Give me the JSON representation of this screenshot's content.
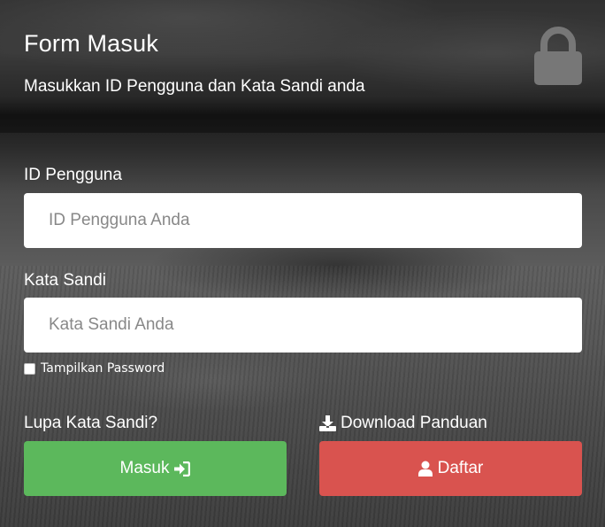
{
  "header": {
    "title": "Form Masuk",
    "subtitle": "Masukkan ID Pengguna dan Kata Sandi anda",
    "icon": "lock-icon"
  },
  "form": {
    "username": {
      "label": "ID Pengguna",
      "placeholder": "ID Pengguna Anda",
      "value": ""
    },
    "password": {
      "label": "Kata Sandi",
      "placeholder": "Kata Sandi Anda",
      "value": ""
    },
    "show_password": {
      "label": "Tampilkan Password",
      "checked": false
    }
  },
  "links": {
    "forgot_password": "Lupa Kata Sandi?",
    "download_guide": "Download Panduan",
    "download_icon": "download-icon"
  },
  "buttons": {
    "login": {
      "label": "Masuk",
      "icon": "sign-in-icon",
      "color": "#5cb85c"
    },
    "register": {
      "label": "Daftar",
      "icon": "user-icon",
      "color": "#d9534f"
    }
  }
}
